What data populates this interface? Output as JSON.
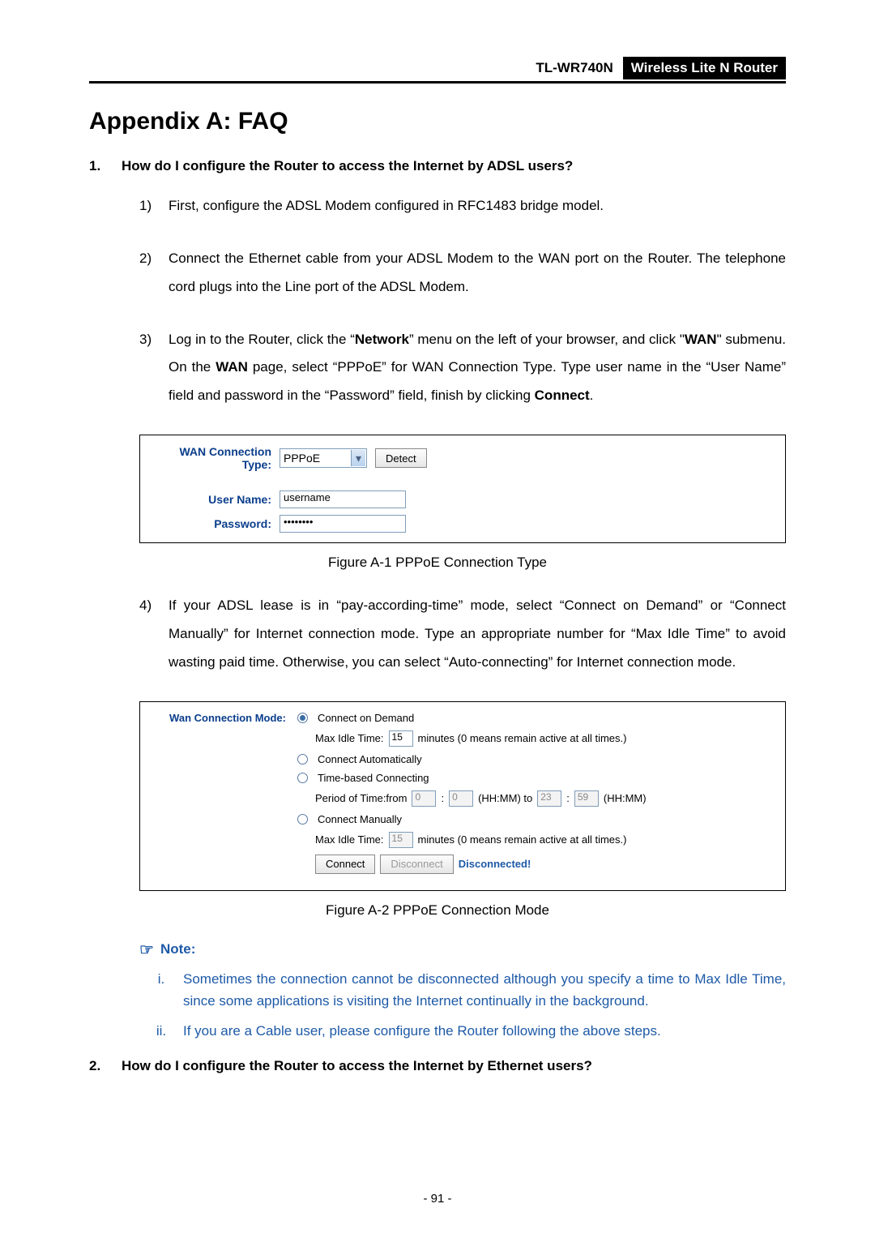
{
  "header": {
    "model": "TL-WR740N",
    "product": "Wireless Lite N Router"
  },
  "title": "Appendix A: FAQ",
  "q1": {
    "num": "1.",
    "text": "How do I configure the Router to access the Internet by ADSL users?",
    "s1": {
      "num": "1)",
      "body": "First, configure the ADSL Modem configured in RFC1483 bridge model."
    },
    "s2": {
      "num": "2)",
      "body": "Connect the Ethernet cable from your ADSL Modem to the WAN port on the Router. The telephone cord plugs into the Line port of the ADSL Modem."
    },
    "s3": {
      "num": "3)",
      "part_a": "Log in to the Router, click the “",
      "bold_a": "Network",
      "part_b": "” menu on the left of your browser, and click \"",
      "bold_b": "WAN",
      "part_c": "\" submenu. On the ",
      "bold_c": "WAN",
      "part_d": " page, select “PPPoE” for WAN Connection Type. Type user name in the “User Name” field and password in the “Password” field, finish by clicking ",
      "bold_d": "Connect",
      "part_e": "."
    },
    "s4": {
      "num": "4)",
      "body": "If your ADSL lease is in “pay-according-time” mode, select “Connect on Demand” or “Connect Manually” for Internet connection mode. Type an appropriate number for “Max Idle Time” to avoid wasting paid time. Otherwise, you can select “Auto-connecting” for Internet connection mode."
    }
  },
  "fig1": {
    "caption": "Figure A-1    PPPoE Connection Type",
    "labels": {
      "conn_type": "WAN Connection Type:",
      "user": "User Name:",
      "pass": "Password:"
    },
    "values": {
      "conn_type": "PPPoE",
      "detect": "Detect",
      "user": "username",
      "pass": "••••••••"
    }
  },
  "fig2": {
    "caption": "Figure A-2    PPPoE Connection Mode",
    "label": "Wan Connection Mode:",
    "opts": {
      "demand": "Connect on Demand",
      "auto": "Connect Automatically",
      "time": "Time-based Connecting",
      "manual": "Connect Manually"
    },
    "max_idle": "Max Idle Time:",
    "idle_val1": "15",
    "idle_val2": "15",
    "idle_suffix": "minutes (0 means remain active at all times.)",
    "period": "Period of Time:from",
    "p_h1": "0",
    "p_m1": "0",
    "p_mid": "(HH:MM) to",
    "p_h2": "23",
    "p_m2": "59",
    "p_end": "(HH:MM)",
    "connect": "Connect",
    "disconnect": "Disconnect",
    "status": "Disconnected!"
  },
  "note": {
    "head": "Note:",
    "i": {
      "num": "i.",
      "body": "Sometimes the connection cannot be disconnected although you specify a time to Max Idle Time, since some applications is visiting the Internet continually in the background."
    },
    "ii": {
      "num": "ii.",
      "body": "If you are a Cable user, please configure the Router following the above steps."
    }
  },
  "q2": {
    "num": "2.",
    "text": "How do I configure the Router to access the Internet by Ethernet users?"
  },
  "page_num": "- 91 -"
}
